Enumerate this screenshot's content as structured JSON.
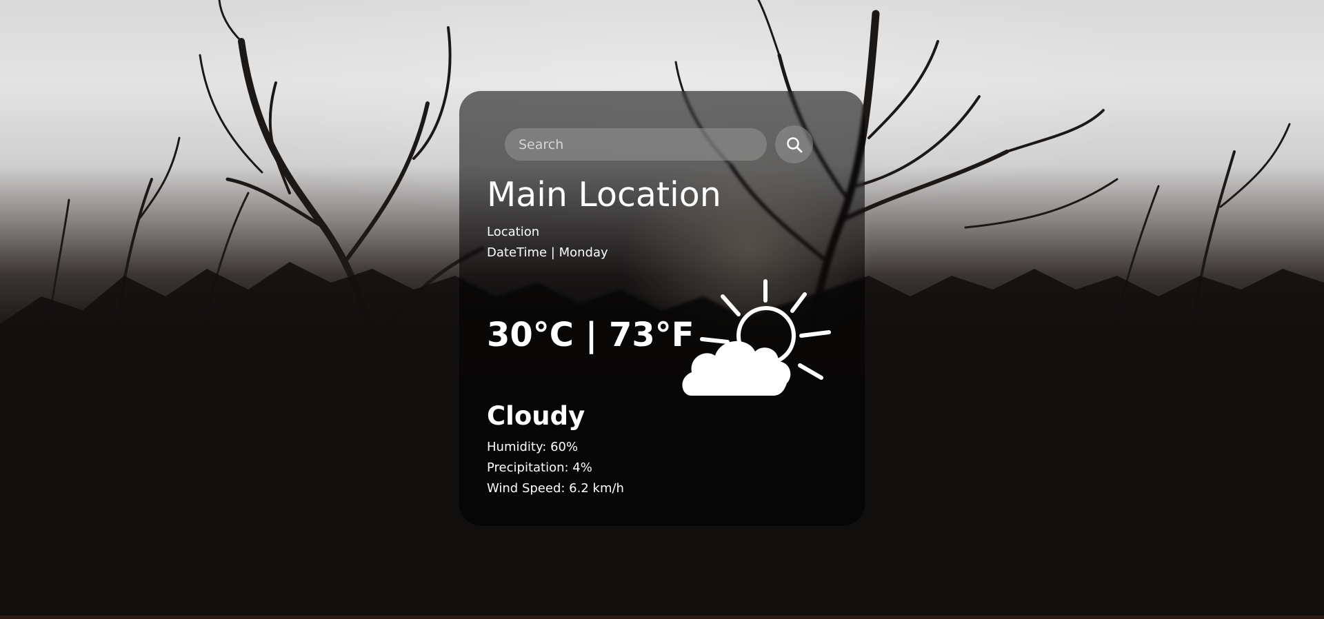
{
  "search": {
    "placeholder": "Search",
    "button_icon": "search-icon"
  },
  "location": {
    "main": "Main Location",
    "sub": "Location",
    "datetime": "DateTime | Monday"
  },
  "weather": {
    "temperature": "30°C | 73°F",
    "condition": "Cloudy",
    "icon": "partly-cloudy-icon",
    "humidity": "Humidity: 60%",
    "precipitation": "Precipitation: 4%",
    "wind": "Wind Speed: 6.2 km/h"
  },
  "colors": {
    "card_bg": "#000000",
    "text": "#ffffff",
    "input_bg": "#969696"
  }
}
